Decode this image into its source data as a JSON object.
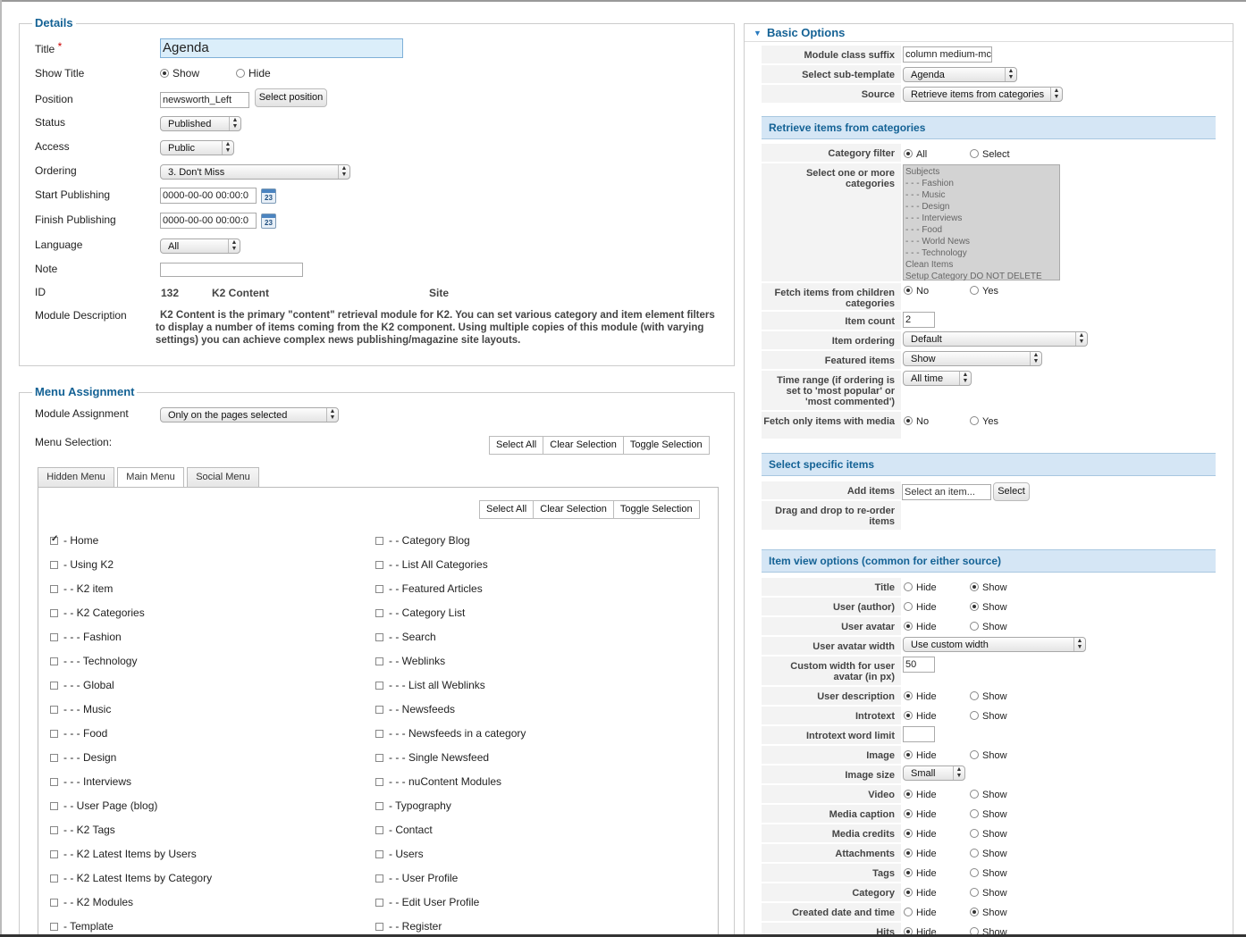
{
  "details": {
    "legend": "Details",
    "title_label": "Title",
    "required_star": "*",
    "title_value": "Agenda",
    "show_title_label": "Show Title",
    "show_opt": "Show",
    "hide_opt": "Hide",
    "position_label": "Position",
    "position_value": "newsworth_Left",
    "select_position_btn": "Select position",
    "status_label": "Status",
    "status_value": "Published",
    "access_label": "Access",
    "access_value": "Public",
    "ordering_label": "Ordering",
    "ordering_value": "3. Don't Miss",
    "start_label": "Start Publishing",
    "start_value": "0000-00-00 00:00:0",
    "finish_label": "Finish Publishing",
    "finish_value": "0000-00-00 00:00:0",
    "calendar_day": "23",
    "language_label": "Language",
    "language_value": "All",
    "note_label": "Note",
    "note_value": "",
    "id_label": "ID",
    "id_value": "132",
    "module_type": "K2 Content",
    "client": "Site",
    "desc_label": "Module Description",
    "desc_text": "K2 Content is the primary \"content\" retrieval module for K2. You can set various category and item element filters to display a number of items coming from the K2 component. Using multiple copies of this module (with varying settings) you can achieve complex news publishing/magazine site layouts."
  },
  "menu_assignment": {
    "legend": "Menu Assignment",
    "module_assignment_label": "Module Assignment",
    "module_assignment_value": "Only on the pages selected",
    "menu_selection_label": "Menu Selection:",
    "select_all": "Select All",
    "clear_selection": "Clear Selection",
    "toggle_selection": "Toggle Selection",
    "tabs": [
      "Hidden Menu",
      "Main Menu",
      "Social Menu"
    ],
    "left_items": [
      {
        "label": "- Home",
        "checked": true
      },
      {
        "label": "- Using K2",
        "checked": false
      },
      {
        "label": "- - K2 item",
        "checked": false
      },
      {
        "label": "- - K2 Categories",
        "checked": false
      },
      {
        "label": "- - - Fashion",
        "checked": false
      },
      {
        "label": "- - - Technology",
        "checked": false
      },
      {
        "label": "- - - Global",
        "checked": false
      },
      {
        "label": "- - - Music",
        "checked": false
      },
      {
        "label": "- - - Food",
        "checked": false
      },
      {
        "label": "- - - Design",
        "checked": false
      },
      {
        "label": "- - - Interviews",
        "checked": false
      },
      {
        "label": "- - User Page (blog)",
        "checked": false
      },
      {
        "label": "- - K2 Tags",
        "checked": false
      },
      {
        "label": "- - K2 Latest Items by Users",
        "checked": false
      },
      {
        "label": "- - K2 Latest Items by Category",
        "checked": false
      },
      {
        "label": "- - K2 Modules",
        "checked": false
      },
      {
        "label": "- Template",
        "checked": false
      }
    ],
    "right_items": [
      {
        "label": "- - Category Blog",
        "checked": false
      },
      {
        "label": "- - List All Categories",
        "checked": false
      },
      {
        "label": "- - Featured Articles",
        "checked": false
      },
      {
        "label": "- - Category List",
        "checked": false
      },
      {
        "label": "- - Search",
        "checked": false
      },
      {
        "label": "- - Weblinks",
        "checked": false
      },
      {
        "label": "- - - List all Weblinks",
        "checked": false
      },
      {
        "label": "- - Newsfeeds",
        "checked": false
      },
      {
        "label": "- - - Newsfeeds in a category",
        "checked": false
      },
      {
        "label": "- - - Single Newsfeed",
        "checked": false
      },
      {
        "label": "- - - nuContent Modules",
        "checked": false
      },
      {
        "label": "- Typography",
        "checked": false
      },
      {
        "label": "- Contact",
        "checked": false
      },
      {
        "label": "- Users",
        "checked": false
      },
      {
        "label": "- - User Profile",
        "checked": false
      },
      {
        "label": "- - Edit User Profile",
        "checked": false
      },
      {
        "label": "- - Register",
        "checked": false
      }
    ]
  },
  "basic_options": {
    "title": "Basic Options",
    "module_class_suffix_label": "Module class suffix",
    "module_class_suffix_value": "column medium-mc",
    "sub_template_label": "Select sub-template",
    "sub_template_value": "Agenda",
    "source_label": "Source",
    "source_value": "Retrieve items from categories"
  },
  "retrieve": {
    "header": "Retrieve items from categories",
    "category_filter_label": "Category filter",
    "all_opt": "All",
    "select_opt": "Select",
    "select_cats_label": "Select one or more categories",
    "categories": [
      "Subjects",
      "- - - Fashion",
      "- - - Music",
      "- - - Design",
      "- - - Interviews",
      "- - - Food",
      "- - - World News",
      "- - - Technology",
      "Clean Items",
      "Setup Category DO NOT DELETE"
    ],
    "fetch_children_label": "Fetch items from children categories",
    "no_opt": "No",
    "yes_opt": "Yes",
    "item_count_label": "Item count",
    "item_count_value": "2",
    "item_ordering_label": "Item ordering",
    "item_ordering_value": "Default",
    "featured_label": "Featured items",
    "featured_value": "Show",
    "time_range_label": "Time range (if ordering is set to 'most popular' or 'most commented')",
    "time_range_value": "All time",
    "fetch_media_label": "Fetch only items with media"
  },
  "specific": {
    "header": "Select specific items",
    "add_items_label": "Add items",
    "add_items_placeholder": "Select an item...",
    "select_btn": "Select",
    "drag_label": "Drag and drop to re-order items"
  },
  "item_view": {
    "header": "Item view options (common for either source)",
    "hide_opt": "Hide",
    "show_opt": "Show",
    "title_label": "Title",
    "user_author_label": "User (author)",
    "user_avatar_label": "User avatar",
    "avatar_width_label": "User avatar width",
    "avatar_width_value": "Use custom width",
    "custom_width_label": "Custom width for user avatar (in px)",
    "custom_width_value": "50",
    "user_desc_label": "User description",
    "introtext_label": "Introtext",
    "introtext_limit_label": "Introtext word limit",
    "introtext_limit_value": "",
    "image_label": "Image",
    "image_size_label": "Image size",
    "image_size_value": "Small",
    "video_label": "Video",
    "media_caption_label": "Media caption",
    "media_credits_label": "Media credits",
    "attachments_label": "Attachments",
    "tags_label": "Tags",
    "category_label": "Category",
    "created_label": "Created date and time",
    "hits_label": "Hits"
  }
}
